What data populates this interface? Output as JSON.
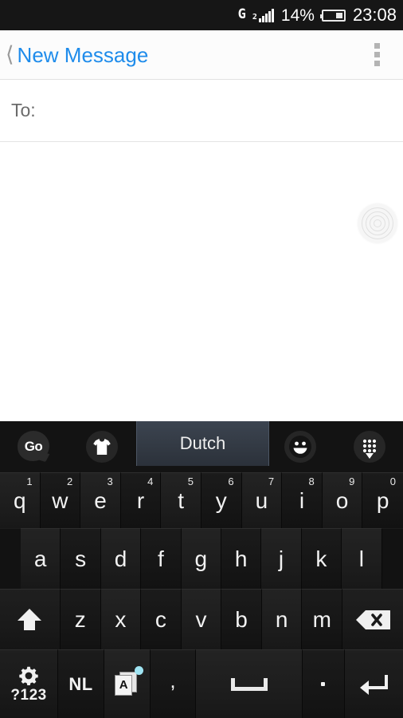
{
  "statusbar": {
    "network_type": "G",
    "sim_indicator": "2",
    "battery_percent": "14%",
    "clock": "23:08",
    "signal_icon": "signal-bars-icon",
    "battery_icon": "battery-icon"
  },
  "appbar": {
    "back_icon": "back-chevron-icon",
    "title": "New Message",
    "overflow_icon": "overflow-menu-icon",
    "title_color": "#1f8ceb"
  },
  "compose": {
    "to_label": "To:",
    "body_value": "",
    "assistive_touch_icon": "assistive-touch-button"
  },
  "keyboard": {
    "toolbar": {
      "go_logo_label": "Go",
      "theme_icon": "tshirt-theme-icon",
      "language_label": "Dutch",
      "emoji_icon": "emoji-smiley-icon",
      "keypad_icon": "keypad-grid-icon"
    },
    "row1": [
      {
        "label": "q",
        "num": "1"
      },
      {
        "label": "w",
        "num": "2"
      },
      {
        "label": "e",
        "num": "3"
      },
      {
        "label": "r",
        "num": "4"
      },
      {
        "label": "t",
        "num": "5"
      },
      {
        "label": "y",
        "num": "6"
      },
      {
        "label": "u",
        "num": "7"
      },
      {
        "label": "i",
        "num": "8"
      },
      {
        "label": "o",
        "num": "9"
      },
      {
        "label": "p",
        "num": "0"
      }
    ],
    "row2": [
      {
        "label": "a"
      },
      {
        "label": "s"
      },
      {
        "label": "d"
      },
      {
        "label": "f"
      },
      {
        "label": "g"
      },
      {
        "label": "h"
      },
      {
        "label": "j"
      },
      {
        "label": "k"
      },
      {
        "label": "l"
      }
    ],
    "row3": {
      "shift_icon": "shift-arrow-icon",
      "letters": [
        {
          "label": "z"
        },
        {
          "label": "x"
        },
        {
          "label": "c"
        },
        {
          "label": "v"
        },
        {
          "label": "b"
        },
        {
          "label": "n"
        },
        {
          "label": "m"
        }
      ],
      "backspace_icon": "backspace-icon"
    },
    "row4": {
      "settings_icon": "gear-icon",
      "symbols_label": "?123",
      "language_label": "NL",
      "lang_switch_letter": "A",
      "lang_switch_icon": "language-switch-icon",
      "comma_label": ",",
      "space_icon": "space-bar-icon",
      "period_label": ".",
      "enter_icon": "enter-return-icon"
    }
  }
}
